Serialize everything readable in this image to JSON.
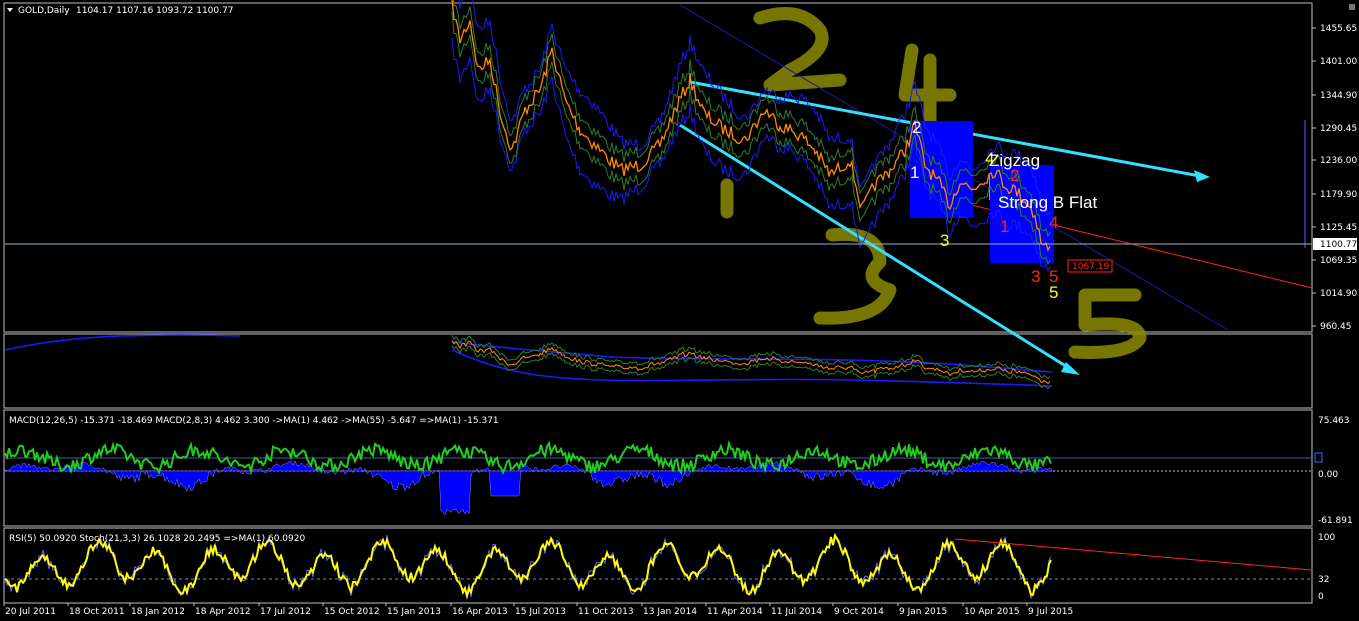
{
  "header": {
    "symbol": "GOLD,Daily",
    "ohlc": "1104.17 1107.16 1093.72 1100.77"
  },
  "colors": {
    "background": "#000000",
    "price_line": "#ff8c00",
    "bands": "#1a1aff",
    "env": "#2f7d2f",
    "trend_arrow": "#33e0ff",
    "macd_main": "#22cc22",
    "macd_hist": "#0000ff",
    "stoch": "#ffff00",
    "stoch_signal": "#6a6aff",
    "red_trend": "#ff2222",
    "marker_box": "#0000ff",
    "scribble": "#8b8b00"
  },
  "price_axis": {
    "labels": [
      "1455.65",
      "1401.00",
      "1344.90",
      "1290.45",
      "1236.00",
      "1179.90",
      "1125.45",
      "1069.35",
      "1014.90",
      "960.45"
    ],
    "current": "1100.77",
    "marker": "1067.19"
  },
  "ma_panel": {},
  "macd_panel": {
    "title": "MACD(12,26,5) -15.371 -18.469  MACD(2,8,3) 4.462 3.300  ->MA(1) 4.462  ->MA(55) -5.647  =>MA(1) -15.371",
    "axis": [
      "75.463",
      "0.00",
      "-61.891"
    ]
  },
  "stoch_panel": {
    "title": "RSI(5) 50.0920  Stoch(21,3,3) 26.1028 20.2495  =>MA(1) 60.0920",
    "axis": [
      "100",
      "32",
      "0"
    ]
  },
  "time_axis": [
    "20 Jul 2011",
    "18 Oct 2011",
    "18 Jan 2012",
    "18 Apr 2012",
    "17 Jul 2012",
    "15 Oct 2012",
    "15 Jan 2013",
    "16 Apr 2013",
    "15 Jul 2013",
    "11 Oct 2013",
    "13 Jan 2014",
    "11 Apr 2014",
    "11 Jul 2014",
    "9 Oct 2014",
    "9 Jan 2015",
    "10 Apr 2015",
    "9 Jul 2015"
  ],
  "wave_labels": {
    "w1": "1",
    "w2": "2",
    "w3": "3",
    "w4": "4",
    "w5": "5",
    "b1": "1",
    "b2": "2",
    "b3": "3",
    "b4": "4",
    "b5": "5",
    "ww4": "4"
  },
  "annotations": {
    "zigzag": "Zigzag",
    "flat": "Strong B Flat"
  },
  "scribbles": {
    "s2": "2",
    "s4": "4",
    "s3": "3",
    "s1": "1",
    "s5": "5"
  }
}
